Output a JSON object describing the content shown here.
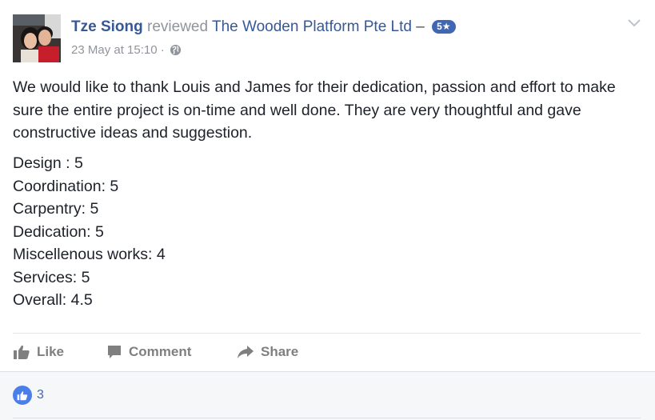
{
  "post": {
    "author": "Tze Siong",
    "verb": "reviewed",
    "page_name": "The Wooden Platform Pte Ltd",
    "separator": "–",
    "rating_badge": "5★",
    "timestamp": "23 May at 15:10",
    "dot": "·",
    "privacy_icon": "globe-icon",
    "body": "We would like to thank Louis and James for their dedication, passion and effort to make sure the entire project is on-time and well done. They are very thoughtful and gave constructive ideas and suggestion.",
    "ratings": [
      "Design : 5",
      "Coordination: 5",
      "Carpentry: 5",
      "Dedication: 5",
      "Miscellenous works: 4",
      "Services: 5",
      "Overall: 4.5"
    ]
  },
  "actions": {
    "like": "Like",
    "comment": "Comment",
    "share": "Share"
  },
  "reactions": {
    "count": "3"
  },
  "colors": {
    "link": "#365899",
    "muted": "#90949c",
    "badge": "#4267b2",
    "like_blue": "#4a7ee8",
    "action_gray": "#7f7f7f"
  }
}
